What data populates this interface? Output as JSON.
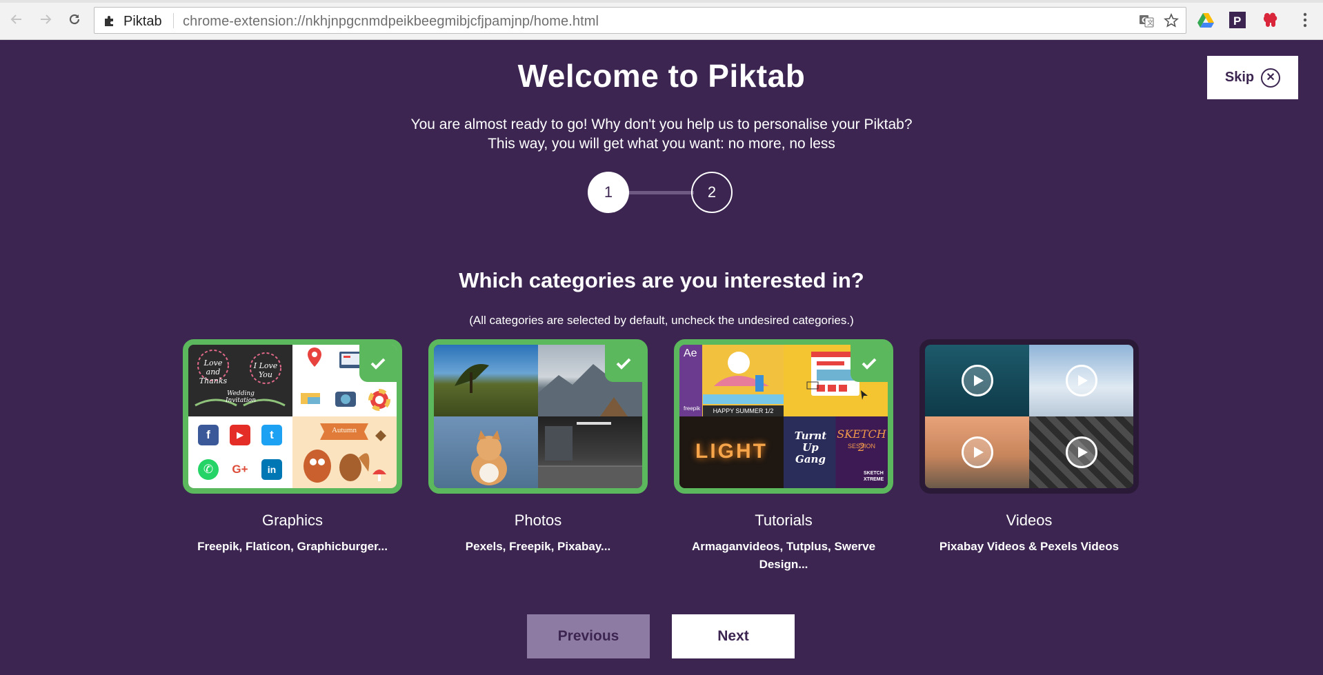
{
  "browser": {
    "site_name": "Piktab",
    "url": "chrome-extension://nkhjnpgcnmdpeikbeegmibjcfjpamjnp/home.html"
  },
  "header": {
    "title": "Welcome to Piktab",
    "subtitle_line1": "You are almost ready to go! Why don't you help us to personalise your Piktab?",
    "subtitle_line2": "This way, you will get what you want: no more, no less",
    "skip_label": "Skip"
  },
  "stepper": {
    "steps": [
      "1",
      "2"
    ],
    "current": 1
  },
  "question": {
    "title": "Which categories are you interested in?",
    "note": "(All categories are selected by default, uncheck the undesired categories.)"
  },
  "categories": [
    {
      "name": "Graphics",
      "sources": "Freepik, Flaticon, Graphicburger...",
      "selected": true
    },
    {
      "name": "Photos",
      "sources": "Pexels, Freepik, Pixabay...",
      "selected": true
    },
    {
      "name": "Tutorials",
      "sources": "Armaganvideos, Tutplus, Swerve Design...",
      "selected": true
    },
    {
      "name": "Videos",
      "sources": "Pixabay Videos & Pexels Videos",
      "selected": false
    }
  ],
  "tile_text": {
    "love_thanks": "Love and Thanks",
    "love_you": "I Love You",
    "wedding": "Wedding Invitation",
    "autumn": "Autumn",
    "ae": "Ae",
    "happy_summer": "HAPPY SUMMER 1/2",
    "freepik": "freepik",
    "light": "LIGHT",
    "turnt": "Turnt Up Gang",
    "sketch": "SKETCH 2",
    "sketch_session": "SESSION",
    "sketch_xtreme": "SKETCH XTREME"
  },
  "social_icons": {
    "facebook": "f",
    "youtube": "▶",
    "twitter": "t",
    "whatsapp": "✆",
    "googleplus": "G+",
    "linkedin": "in"
  },
  "buttons": {
    "previous": "Previous",
    "next": "Next"
  },
  "colors": {
    "background": "#3c2651",
    "selected_border": "#5cb85c",
    "previous_button": "#8e7ba3",
    "brand_text": "#3c2651"
  },
  "icons": {
    "back": "arrow-left-icon",
    "forward": "arrow-right-icon",
    "reload": "reload-icon",
    "extension": "puzzle-icon",
    "translate": "translate-icon",
    "bookmark": "star-icon",
    "drive": "google-drive-icon",
    "p_ext": "p-extension-icon",
    "red_ext": "red-extension-icon",
    "menu": "kebab-menu-icon",
    "check": "check-icon",
    "play": "play-icon",
    "close": "close-icon"
  }
}
